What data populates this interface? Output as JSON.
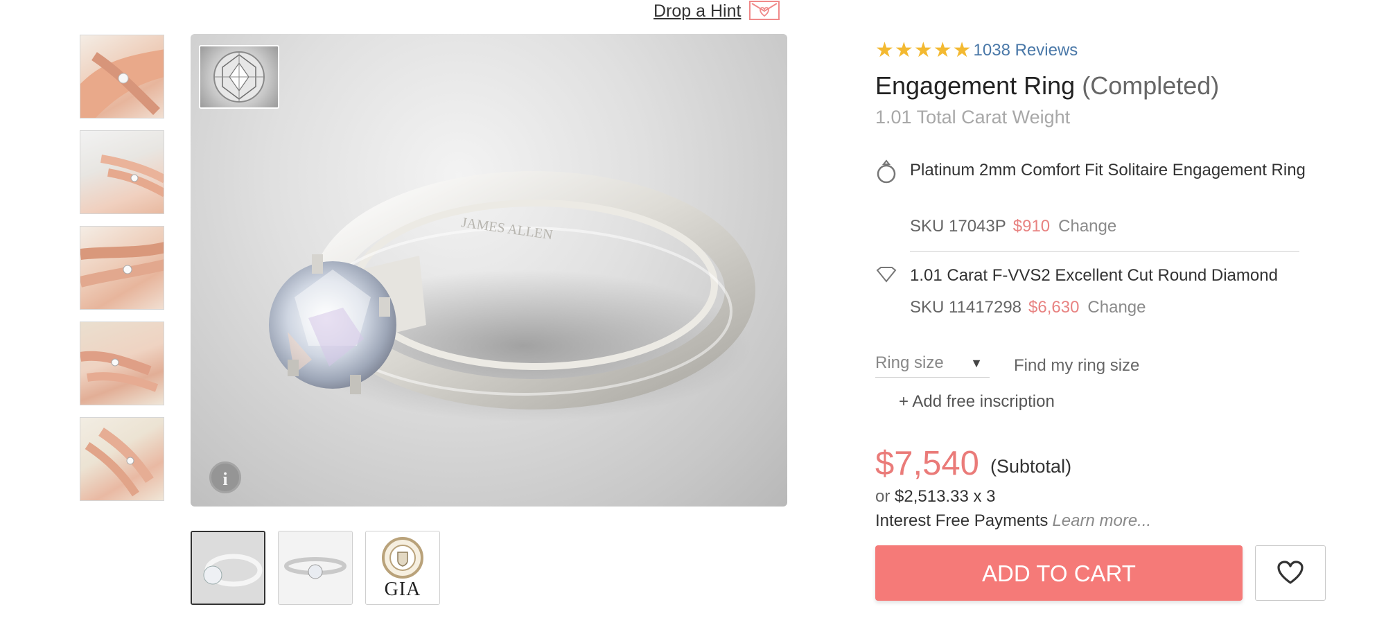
{
  "hint": {
    "label": "Drop a Hint",
    "icon": "heart-envelope-icon"
  },
  "gallery": {
    "side_thumbnails": [
      "hand-ring-photo-1",
      "hand-ring-photo-2",
      "hand-ring-photo-3",
      "hand-ring-photo-4",
      "hand-ring-photo-5"
    ],
    "bottom_thumbnails": [
      {
        "kind": "ring-angle-view",
        "active": true
      },
      {
        "kind": "ring-side-view",
        "active": false
      },
      {
        "kind": "certificate-seal",
        "label": "GIA",
        "active": false
      }
    ],
    "info_icon": "i"
  },
  "product": {
    "rating": 5,
    "reviews": "1038 Reviews",
    "title": "Engagement Ring",
    "title_status": "(Completed)",
    "carat_weight": "1.01 Total Carat Weight",
    "setting": {
      "icon": "ring-icon",
      "name": "Platinum 2mm Comfort Fit Solitaire Engagement Ring",
      "sku": "SKU 17043P",
      "price": "$910",
      "change": "Change"
    },
    "diamond": {
      "icon": "diamond-icon",
      "name": "1.01 Carat F-VVS2 Excellent Cut Round Diamond",
      "sku": "SKU 11417298",
      "price": "$6,630",
      "change": "Change"
    },
    "ring_size_placeholder": "Ring size",
    "find_ring_size": "Find my ring size",
    "add_inscription": "+ Add free inscription",
    "price": "$7,540",
    "subtotal_label": "(Subtotal)",
    "installment_prefix": "or",
    "installment_amount": "$2,513.33 x 3",
    "interest_text": "Interest Free Payments",
    "learn_more": "Learn more...",
    "add_to_cart": "ADD TO CART"
  },
  "colors": {
    "accent": "#f57a78",
    "price": "#ea7b79",
    "star": "#f3b931",
    "link": "#4a78a8"
  }
}
